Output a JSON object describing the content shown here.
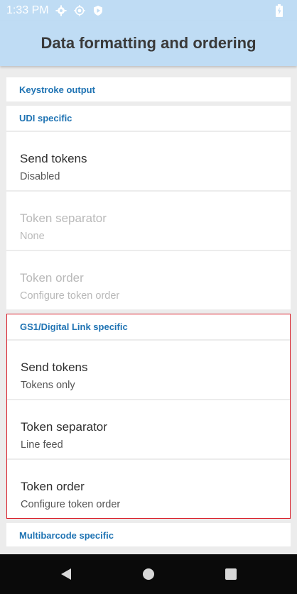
{
  "status_bar": {
    "time": "1:33 PM",
    "icons": [
      "gear-icon",
      "location-target-icon",
      "play-shield-icon"
    ],
    "right_icons": [
      "battery-icon"
    ]
  },
  "app_bar": {
    "title": "Data formatting and ordering"
  },
  "sections": {
    "keystroke": {
      "header": "Keystroke output"
    },
    "udi": {
      "header": "UDI specific",
      "items": [
        {
          "title": "Send tokens",
          "subtitle": "Disabled"
        },
        {
          "title": "Token separator",
          "subtitle": "None"
        },
        {
          "title": "Token order",
          "subtitle": "Configure token order"
        }
      ]
    },
    "gs1": {
      "header": "GS1/Digital Link specific",
      "items": [
        {
          "title": "Send tokens",
          "subtitle": "Tokens only"
        },
        {
          "title": "Token separator",
          "subtitle": "Line feed"
        },
        {
          "title": "Token order",
          "subtitle": "Configure token order"
        }
      ]
    },
    "multi": {
      "header": "Multibarcode specific"
    }
  },
  "colors": {
    "accent": "#1f73b3",
    "app_bar_bg": "#bfdcf4",
    "highlight_border": "#d9202a",
    "disabled_text": "#b9b9b9"
  }
}
